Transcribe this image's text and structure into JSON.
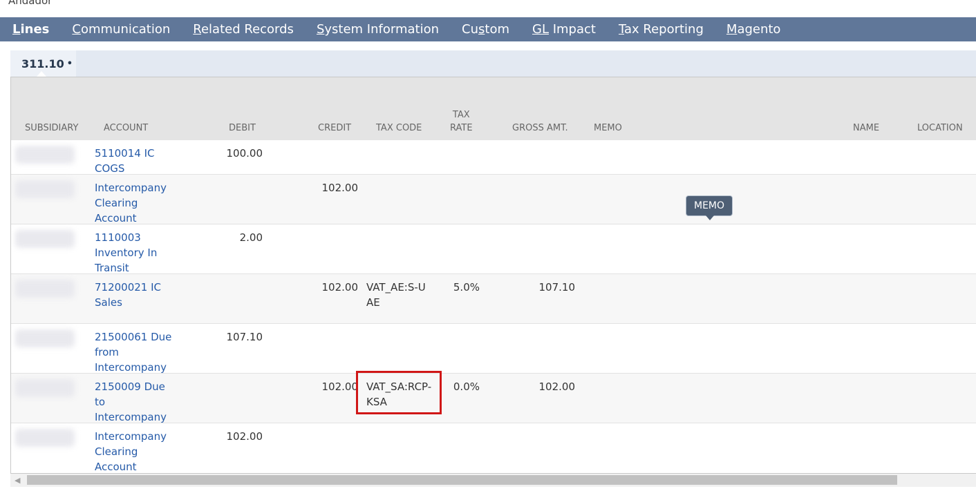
{
  "header": {
    "label": "Andador"
  },
  "tabs": [
    {
      "label": "Lines",
      "accel": "L",
      "rest": "ines"
    },
    {
      "label": "Communication",
      "accel": "C",
      "rest": "ommunication"
    },
    {
      "label": "Related Records",
      "accel": "R",
      "rest": "elated Records"
    },
    {
      "label": "System Information",
      "accel": "S",
      "rest": "ystem Information"
    },
    {
      "label": "Custom",
      "pre": "Cu",
      "accel": "s",
      "rest": "tom"
    },
    {
      "label": "GL Impact",
      "accel": "GL",
      "rest": " Impact"
    },
    {
      "label": "Tax Reporting",
      "accel": "T",
      "rest": "ax Reporting"
    },
    {
      "label": "Magento",
      "accel": "M",
      "rest": "agento"
    }
  ],
  "subtab": {
    "label": "311.10",
    "dot": "•"
  },
  "columns": {
    "subsidiary": "SUBSIDIARY",
    "account": "ACCOUNT",
    "debit": "DEBIT",
    "credit": "CREDIT",
    "tax_code": "TAX CODE",
    "tax_rate_1": "TAX",
    "tax_rate_2": "RATE",
    "gross_amt": "GROSS AMT.",
    "memo": "MEMO",
    "name": "NAME",
    "location": "LOCATION"
  },
  "rows": [
    {
      "account": "5110014 IC COGS",
      "debit": "100.00",
      "credit": "",
      "tax_code": "",
      "tax_rate": "",
      "gross": ""
    },
    {
      "account": "Intercompany Clearing Account",
      "debit": "",
      "credit": "102.00",
      "tax_code": "",
      "tax_rate": "",
      "gross": ""
    },
    {
      "account": "1110003 Inventory In Transit",
      "debit": "2.00",
      "credit": "",
      "tax_code": "",
      "tax_rate": "",
      "gross": ""
    },
    {
      "account": "71200021 IC Sales",
      "debit": "",
      "credit": "102.00",
      "tax_code": "VAT_AE:S-UAE",
      "tax_rate": "5.0%",
      "gross": "107.10"
    },
    {
      "account": "21500061 Due from Intercompany",
      "debit": "107.10",
      "credit": "",
      "tax_code": "",
      "tax_rate": "",
      "gross": ""
    },
    {
      "account": "2150009 Due to Intercompany",
      "debit": "",
      "credit": "102.00",
      "tax_code": "VAT_SA:RCP-KSA",
      "tax_rate": "0.0%",
      "gross": "102.00"
    },
    {
      "account": "Intercompany Clearing Account",
      "debit": "102.00",
      "credit": "",
      "tax_code": "",
      "tax_rate": "",
      "gross": ""
    }
  ],
  "tooltip": {
    "label": "MEMO"
  },
  "colors": {
    "tabbar": "#607799",
    "link": "#255aa8",
    "highlight": "#d01717"
  }
}
